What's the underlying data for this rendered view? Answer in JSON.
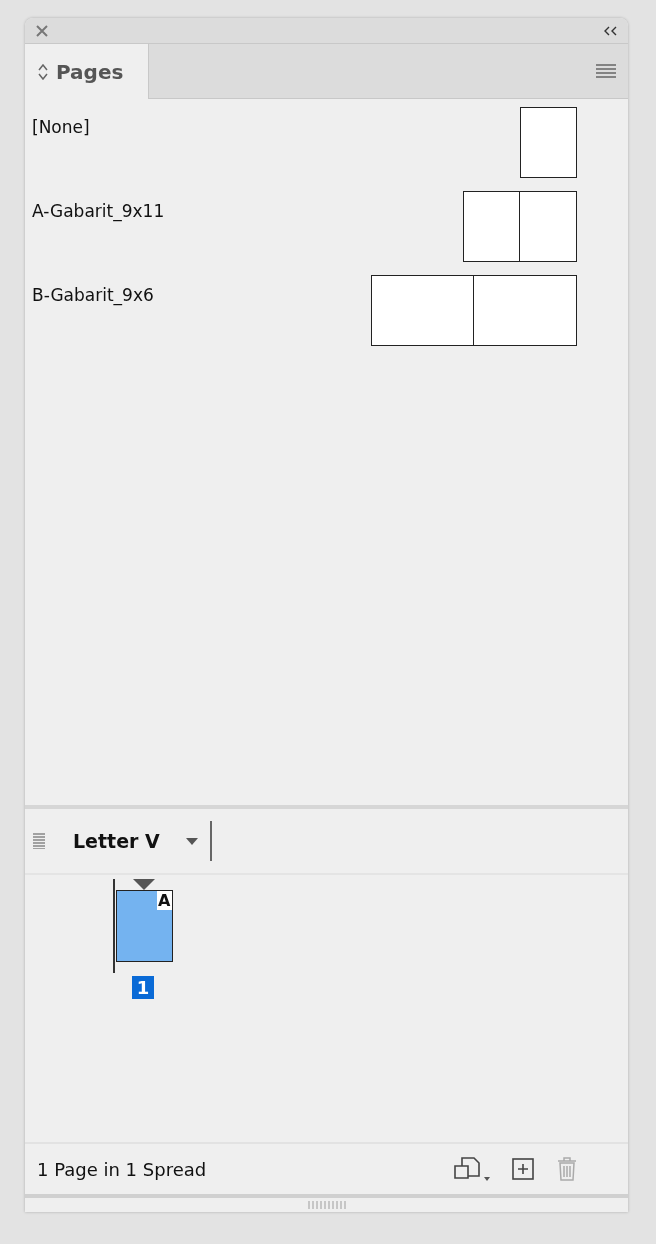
{
  "panel": {
    "tab": {
      "label": "Pages",
      "selected": true
    }
  },
  "masters": [
    {
      "name": "[None]",
      "kind": "single-portrait"
    },
    {
      "name": "A-Gabarit_9x11",
      "kind": "spread-portrait"
    },
    {
      "name": "B-Gabarit_9x6",
      "kind": "spread-landscape"
    }
  ],
  "size_menu": {
    "value": "Letter V"
  },
  "pages": [
    {
      "number": "1",
      "master": "A",
      "selected": true
    }
  ],
  "status_bar": {
    "text": "1 Page in 1 Spread",
    "delete_disabled": true
  }
}
